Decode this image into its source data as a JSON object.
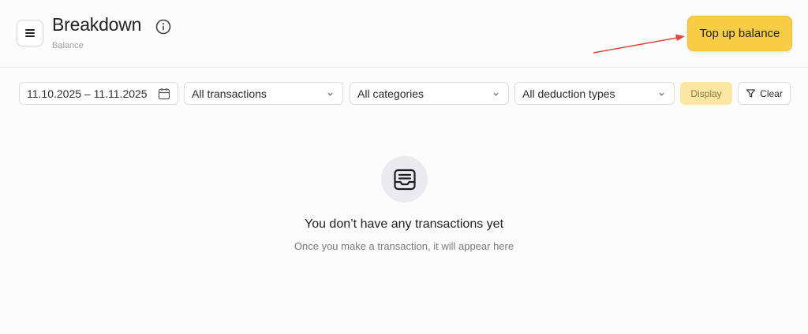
{
  "header": {
    "title": "Breakdown",
    "subtitle": "Balance",
    "topup_label": "Top up balance"
  },
  "filters": {
    "date_range": "11.10.2025 – 11.11.2025",
    "transactions": "All transactions",
    "categories": "All categories",
    "deduction_types": "All deduction types",
    "display_label": "Display",
    "clear_label": "Clear"
  },
  "empty_state": {
    "title": "You don’t have any transactions yet",
    "subtitle": "Once you make a transaction, it will appear here"
  },
  "colors": {
    "accent": "#f7cd45",
    "annotation_arrow": "#e0473a"
  },
  "icons": {
    "menu": "hamburger-icon",
    "info": "info-icon",
    "calendar": "calendar-icon",
    "chevron": "chevron-down-icon",
    "filter": "filter-icon",
    "empty": "inbox-icon"
  }
}
